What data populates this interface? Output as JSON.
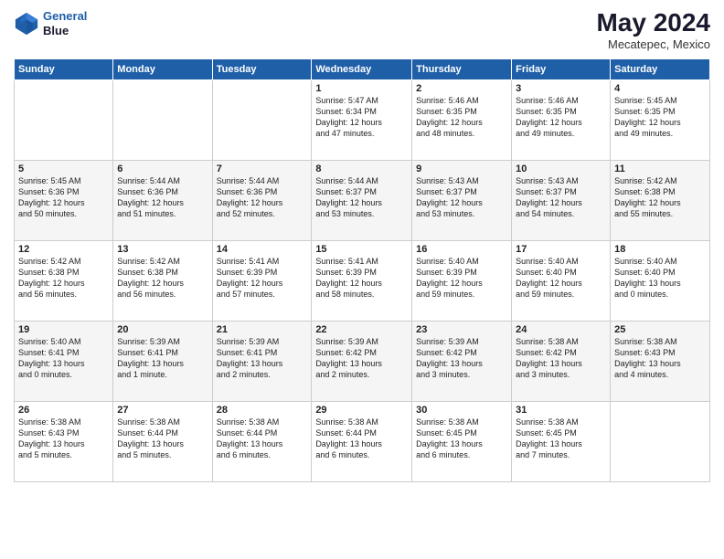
{
  "header": {
    "logo_line1": "General",
    "logo_line2": "Blue",
    "month": "May 2024",
    "location": "Mecatepec, Mexico"
  },
  "weekdays": [
    "Sunday",
    "Monday",
    "Tuesday",
    "Wednesday",
    "Thursday",
    "Friday",
    "Saturday"
  ],
  "weeks": [
    [
      {
        "day": "",
        "text": ""
      },
      {
        "day": "",
        "text": ""
      },
      {
        "day": "",
        "text": ""
      },
      {
        "day": "1",
        "text": "Sunrise: 5:47 AM\nSunset: 6:34 PM\nDaylight: 12 hours\nand 47 minutes."
      },
      {
        "day": "2",
        "text": "Sunrise: 5:46 AM\nSunset: 6:35 PM\nDaylight: 12 hours\nand 48 minutes."
      },
      {
        "day": "3",
        "text": "Sunrise: 5:46 AM\nSunset: 6:35 PM\nDaylight: 12 hours\nand 49 minutes."
      },
      {
        "day": "4",
        "text": "Sunrise: 5:45 AM\nSunset: 6:35 PM\nDaylight: 12 hours\nand 49 minutes."
      }
    ],
    [
      {
        "day": "5",
        "text": "Sunrise: 5:45 AM\nSunset: 6:36 PM\nDaylight: 12 hours\nand 50 minutes."
      },
      {
        "day": "6",
        "text": "Sunrise: 5:44 AM\nSunset: 6:36 PM\nDaylight: 12 hours\nand 51 minutes."
      },
      {
        "day": "7",
        "text": "Sunrise: 5:44 AM\nSunset: 6:36 PM\nDaylight: 12 hours\nand 52 minutes."
      },
      {
        "day": "8",
        "text": "Sunrise: 5:44 AM\nSunset: 6:37 PM\nDaylight: 12 hours\nand 53 minutes."
      },
      {
        "day": "9",
        "text": "Sunrise: 5:43 AM\nSunset: 6:37 PM\nDaylight: 12 hours\nand 53 minutes."
      },
      {
        "day": "10",
        "text": "Sunrise: 5:43 AM\nSunset: 6:37 PM\nDaylight: 12 hours\nand 54 minutes."
      },
      {
        "day": "11",
        "text": "Sunrise: 5:42 AM\nSunset: 6:38 PM\nDaylight: 12 hours\nand 55 minutes."
      }
    ],
    [
      {
        "day": "12",
        "text": "Sunrise: 5:42 AM\nSunset: 6:38 PM\nDaylight: 12 hours\nand 56 minutes."
      },
      {
        "day": "13",
        "text": "Sunrise: 5:42 AM\nSunset: 6:38 PM\nDaylight: 12 hours\nand 56 minutes."
      },
      {
        "day": "14",
        "text": "Sunrise: 5:41 AM\nSunset: 6:39 PM\nDaylight: 12 hours\nand 57 minutes."
      },
      {
        "day": "15",
        "text": "Sunrise: 5:41 AM\nSunset: 6:39 PM\nDaylight: 12 hours\nand 58 minutes."
      },
      {
        "day": "16",
        "text": "Sunrise: 5:40 AM\nSunset: 6:39 PM\nDaylight: 12 hours\nand 59 minutes."
      },
      {
        "day": "17",
        "text": "Sunrise: 5:40 AM\nSunset: 6:40 PM\nDaylight: 12 hours\nand 59 minutes."
      },
      {
        "day": "18",
        "text": "Sunrise: 5:40 AM\nSunset: 6:40 PM\nDaylight: 13 hours\nand 0 minutes."
      }
    ],
    [
      {
        "day": "19",
        "text": "Sunrise: 5:40 AM\nSunset: 6:41 PM\nDaylight: 13 hours\nand 0 minutes."
      },
      {
        "day": "20",
        "text": "Sunrise: 5:39 AM\nSunset: 6:41 PM\nDaylight: 13 hours\nand 1 minute."
      },
      {
        "day": "21",
        "text": "Sunrise: 5:39 AM\nSunset: 6:41 PM\nDaylight: 13 hours\nand 2 minutes."
      },
      {
        "day": "22",
        "text": "Sunrise: 5:39 AM\nSunset: 6:42 PM\nDaylight: 13 hours\nand 2 minutes."
      },
      {
        "day": "23",
        "text": "Sunrise: 5:39 AM\nSunset: 6:42 PM\nDaylight: 13 hours\nand 3 minutes."
      },
      {
        "day": "24",
        "text": "Sunrise: 5:38 AM\nSunset: 6:42 PM\nDaylight: 13 hours\nand 3 minutes."
      },
      {
        "day": "25",
        "text": "Sunrise: 5:38 AM\nSunset: 6:43 PM\nDaylight: 13 hours\nand 4 minutes."
      }
    ],
    [
      {
        "day": "26",
        "text": "Sunrise: 5:38 AM\nSunset: 6:43 PM\nDaylight: 13 hours\nand 5 minutes."
      },
      {
        "day": "27",
        "text": "Sunrise: 5:38 AM\nSunset: 6:44 PM\nDaylight: 13 hours\nand 5 minutes."
      },
      {
        "day": "28",
        "text": "Sunrise: 5:38 AM\nSunset: 6:44 PM\nDaylight: 13 hours\nand 6 minutes."
      },
      {
        "day": "29",
        "text": "Sunrise: 5:38 AM\nSunset: 6:44 PM\nDaylight: 13 hours\nand 6 minutes."
      },
      {
        "day": "30",
        "text": "Sunrise: 5:38 AM\nSunset: 6:45 PM\nDaylight: 13 hours\nand 6 minutes."
      },
      {
        "day": "31",
        "text": "Sunrise: 5:38 AM\nSunset: 6:45 PM\nDaylight: 13 hours\nand 7 minutes."
      },
      {
        "day": "",
        "text": ""
      }
    ]
  ]
}
